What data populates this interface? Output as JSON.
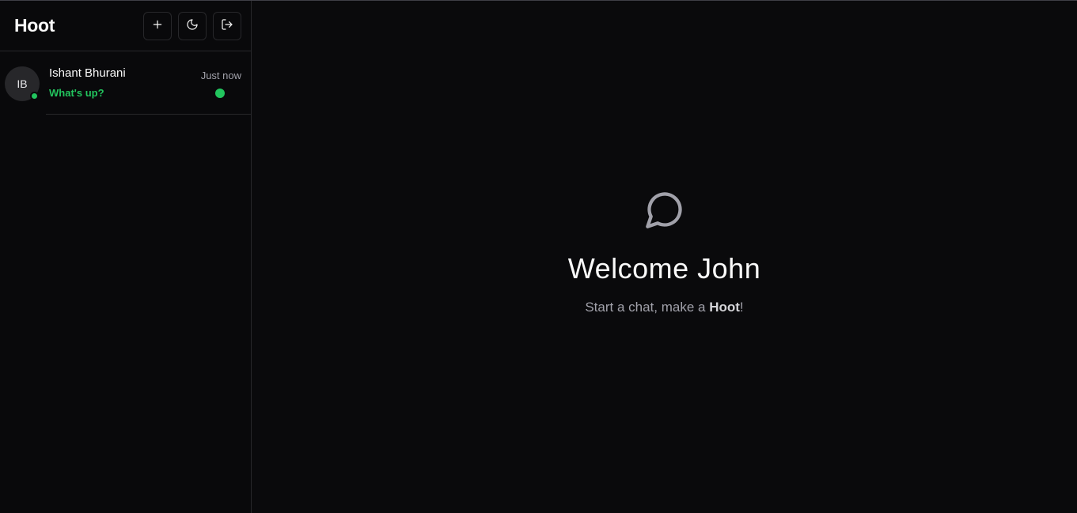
{
  "app": {
    "brand": "Hoot"
  },
  "header": {
    "actions": [
      {
        "icon": "plus-icon",
        "label": "New chat"
      },
      {
        "icon": "moon-icon",
        "label": "Toggle theme"
      },
      {
        "icon": "logout-icon",
        "label": "Log out"
      }
    ]
  },
  "chats": [
    {
      "initials": "IB",
      "name": "Ishant Bhurani",
      "preview": "What's up?",
      "time": "Just now",
      "online": true,
      "unread": true
    }
  ],
  "welcome": {
    "icon": "chat-bubble-icon",
    "title": "Welcome John",
    "subtitle_prefix": "Start a chat, make a ",
    "subtitle_bold": "Hoot",
    "subtitle_suffix": "!"
  },
  "colors": {
    "background": "#09090b",
    "border": "#27272a",
    "accent_green": "#22c55e",
    "muted_text": "#a1a1aa"
  }
}
